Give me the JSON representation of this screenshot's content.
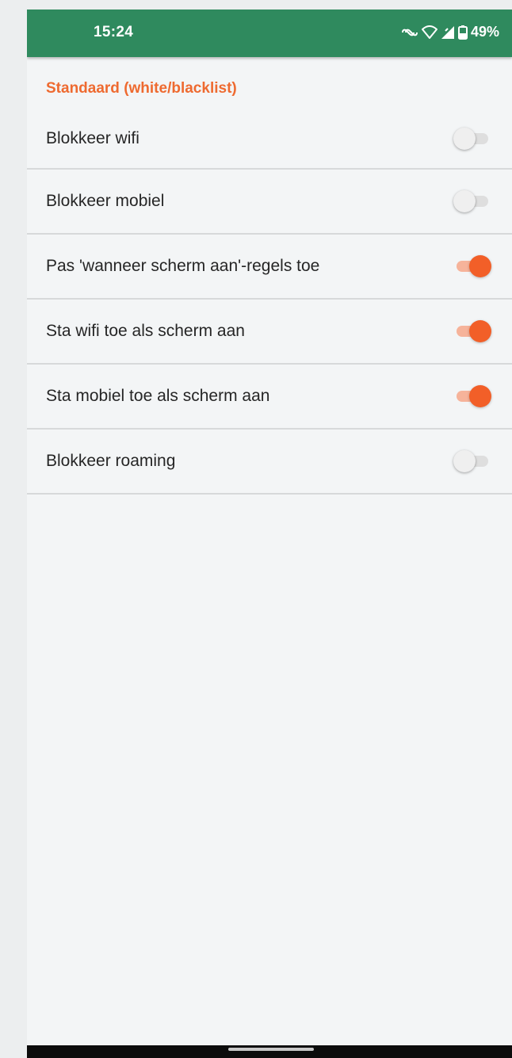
{
  "status_bar": {
    "time": "15:24",
    "battery_percent": "49%",
    "icons": [
      "link-icon",
      "wifi-icon",
      "signal-icon",
      "battery-icon"
    ]
  },
  "section": {
    "title": "Standaard (white/blacklist)"
  },
  "settings": [
    {
      "label": "Blokkeer wifi",
      "enabled": false
    },
    {
      "label": "Blokkeer mobiel",
      "enabled": false
    },
    {
      "label": "Pas 'wanneer scherm aan'-regels toe",
      "enabled": true
    },
    {
      "label": "Sta wifi toe als scherm aan",
      "enabled": true
    },
    {
      "label": "Sta mobiel toe als scherm aan",
      "enabled": true
    },
    {
      "label": "Blokkeer roaming",
      "enabled": false
    }
  ],
  "colors": {
    "status_bar": "#2f8a5e",
    "accent": "#f25f28",
    "accent_track": "#f6b39a",
    "background": "#f3f5f6"
  }
}
